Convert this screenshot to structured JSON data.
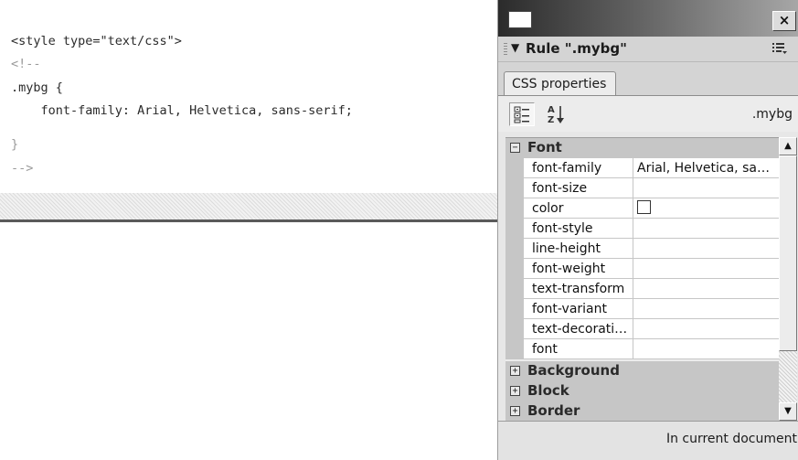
{
  "editor": {
    "lines": [
      "<style type=\"text/css\">",
      "<!--",
      ".mybg {",
      "    font-family: Arial, Helvetica, sans-serif;",
      "}",
      "-->"
    ]
  },
  "panel": {
    "title_icon": "window-icon",
    "close_label": "×",
    "rule_arrow": "▼",
    "rule_title": "Rule \".mybg\"",
    "options_icon": "options-menu-icon",
    "tab_label": "CSS properties",
    "category_view_icon": "category-view-icon",
    "alpha_view_icon": "alphabetical-sort-icon",
    "rule_name": ".mybg",
    "categories": [
      {
        "toggle": "−",
        "label": "Font"
      },
      {
        "toggle": "+",
        "label": "Background"
      },
      {
        "toggle": "+",
        "label": "Block"
      },
      {
        "toggle": "+",
        "label": "Border"
      }
    ],
    "properties": [
      {
        "name": "font-family",
        "value": "Arial, Helvetica, sa…"
      },
      {
        "name": "font-size",
        "value": ""
      },
      {
        "name": "color",
        "value": ""
      },
      {
        "name": "font-style",
        "value": ""
      },
      {
        "name": "line-height",
        "value": ""
      },
      {
        "name": "font-weight",
        "value": ""
      },
      {
        "name": "text-transform",
        "value": ""
      },
      {
        "name": "font-variant",
        "value": ""
      },
      {
        "name": "text-decorati…",
        "value": ""
      },
      {
        "name": "font",
        "value": ""
      }
    ],
    "scroll_up": "▲",
    "scroll_down": "▼",
    "status_text": "In current document"
  }
}
